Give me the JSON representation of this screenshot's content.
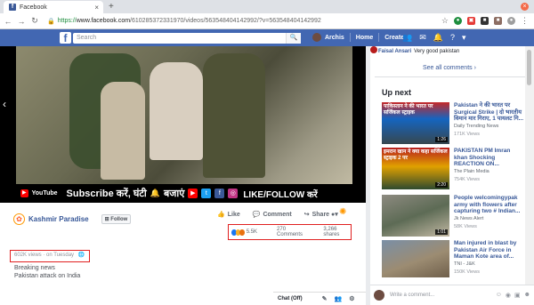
{
  "browser": {
    "tab_title": "Facebook",
    "tab_close": "×",
    "new_tab": "+",
    "url_proto": "https://",
    "url_host": "www.facebook.com",
    "url_path": "/610285372331970/videos/563548404142992/?v=563548404142992"
  },
  "fb": {
    "search_placeholder": "Search",
    "profile_name": "Archis",
    "nav_home": "Home",
    "nav_create": "Create"
  },
  "video": {
    "banner_subscribe": "Subscribe करें, घंटी",
    "banner_bell_word": "बजाएं",
    "banner_like": "LIKE/FOLLOW करें",
    "youtube_word": "YouTube"
  },
  "post": {
    "page_name": "Kashmir Paradise",
    "follow_label": "Follow",
    "like_label": "Like",
    "comment_label": "Comment",
    "share_label": "Share",
    "reactions_count": "5.5K",
    "comments_count": "270 Comments",
    "shares_count": "3,266 shares",
    "views_text": "602K views · on Tuesday",
    "desc_line1": "Breaking news",
    "desc_line2": "Pakistan attack on India"
  },
  "chat": {
    "label": "Chat (Off)"
  },
  "right": {
    "comment_author": "Faisal Ansari",
    "comment_text": "Very good pakistan",
    "see_all": "See all comments",
    "up_next": "Up next",
    "write_comment": "Write a comment...",
    "items": [
      {
        "title": "Pakistan ने की भारत पर Surgical Strike | दो भारतीय विमान मार गिराए, 1 पायलट गि...",
        "source": "Daily Trending News",
        "views": "171K Views",
        "duration": "1:26",
        "thumb_text": "पाकिस्तान ने की भारत पर सर्जिकल स्ट्राइक"
      },
      {
        "title": "PAKISTAN PM Imran khan Shocking REACTION ON...",
        "source": "The Plain Media",
        "views": "754K Views",
        "duration": "2:20",
        "thumb_text": "इमरान खान ने क्या कहा सर्जिकल स्ट्राइक 2 पर"
      },
      {
        "title": "People welcomingypak army with flowers after capturing two # Indian...",
        "source": "Jk News Alert",
        "views": "58K Views",
        "duration": "1:01",
        "thumb_text": ""
      },
      {
        "title": "Man injured in blast by Pakistan Air Force in Maman Kote area of...",
        "source": "TNI - J&K",
        "views": "150K Views",
        "duration": "",
        "thumb_text": ""
      }
    ]
  }
}
